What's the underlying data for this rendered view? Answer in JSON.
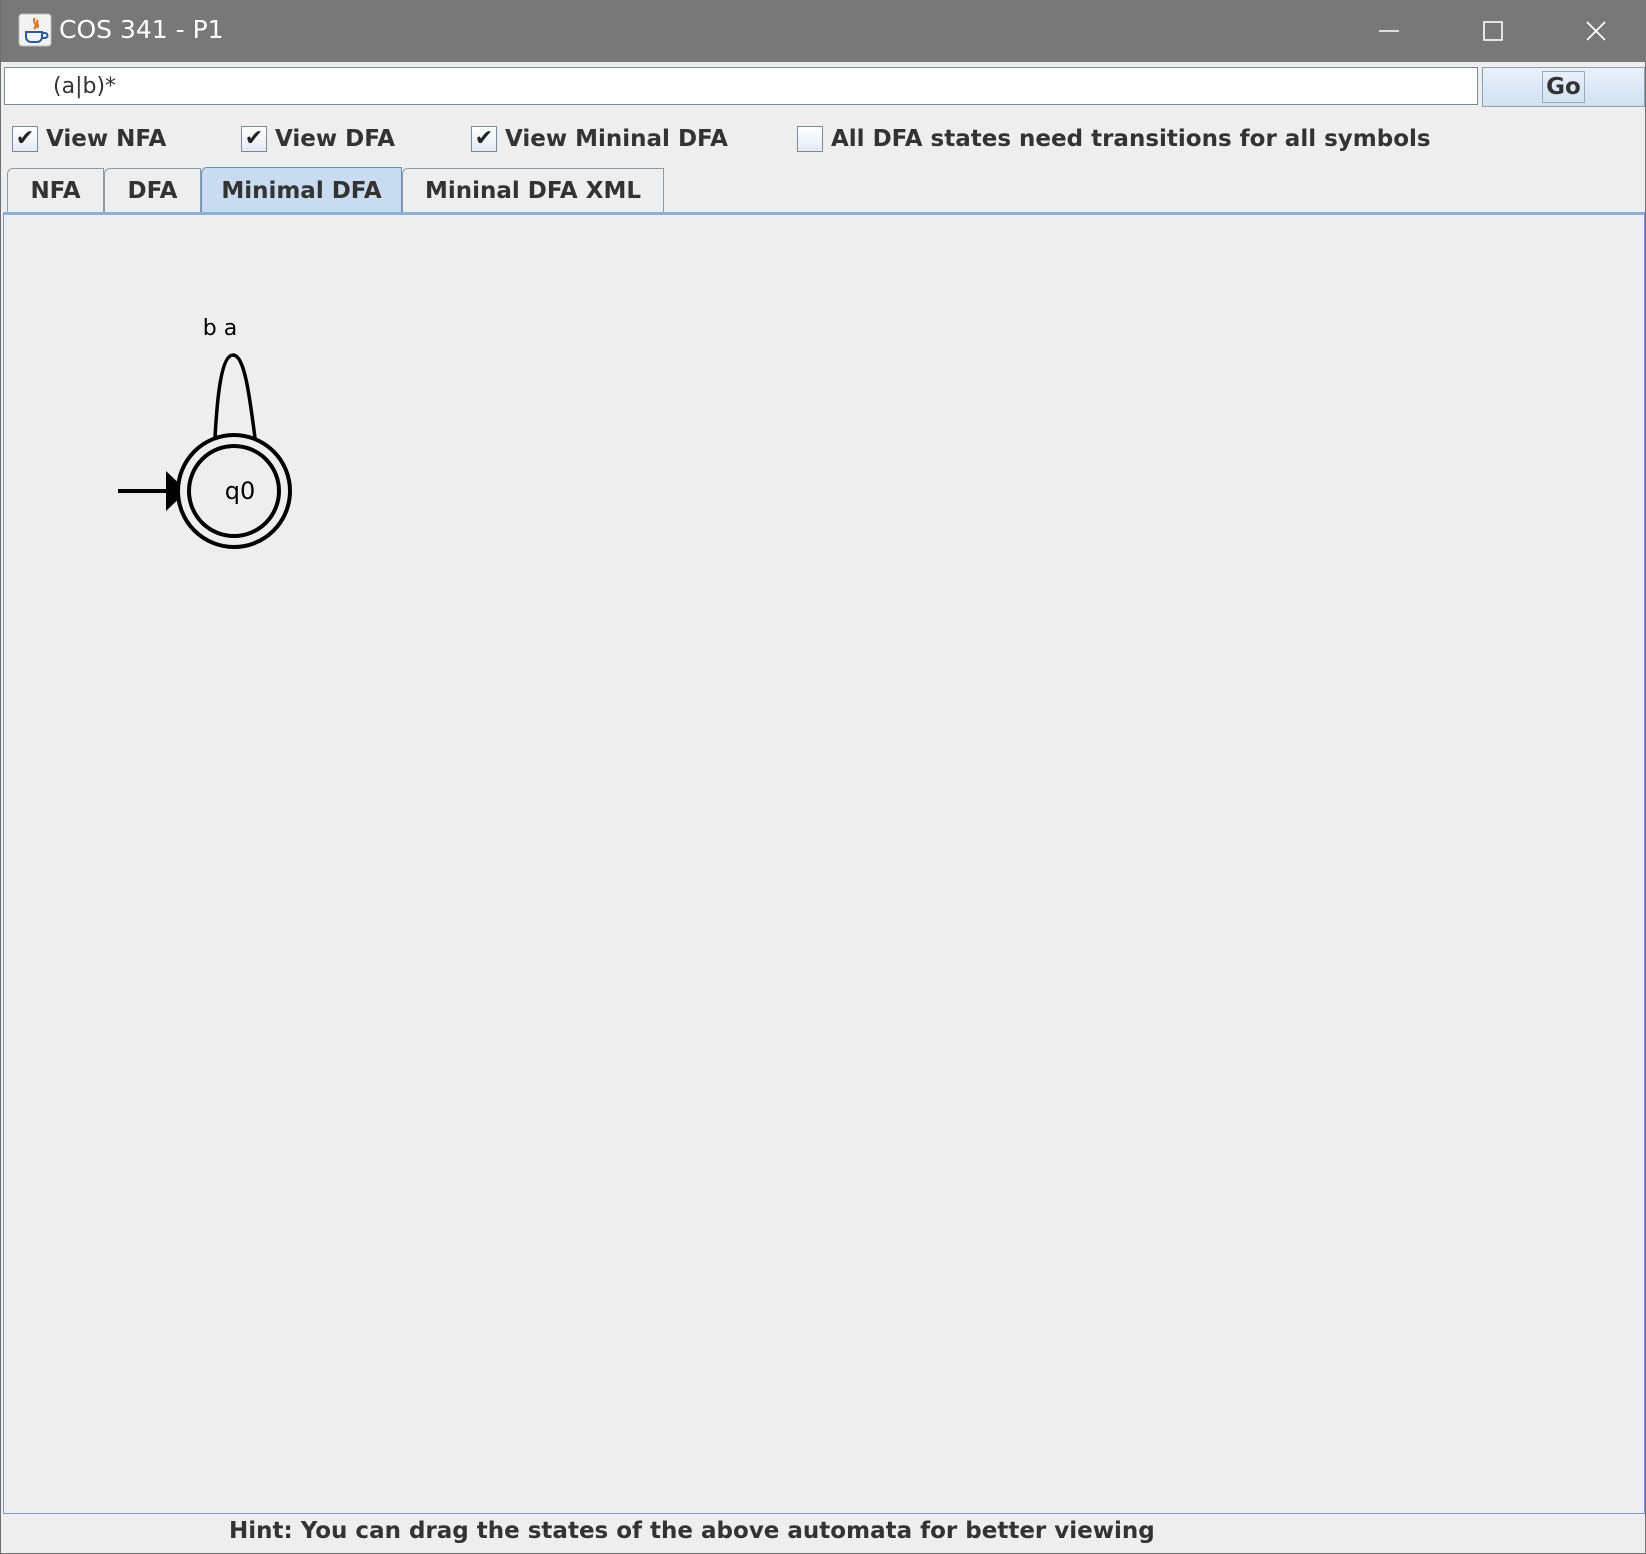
{
  "window": {
    "title": "COS 341 - P1",
    "app_icon": "java-icon",
    "controls": [
      "minimize-icon",
      "maximize-icon",
      "close-icon"
    ]
  },
  "regex": {
    "value": "(a|b)*",
    "go_label": "Go"
  },
  "options": [
    {
      "label": "View NFA",
      "checked": true
    },
    {
      "label": "View DFA",
      "checked": true
    },
    {
      "label": "View Mininal DFA",
      "checked": true
    },
    {
      "label": "All DFA states need transitions for all symbols",
      "checked": false
    }
  ],
  "tabs": [
    {
      "label": "NFA",
      "selected": false
    },
    {
      "label": "DFA",
      "selected": false
    },
    {
      "label": "Minimal DFA",
      "selected": true
    },
    {
      "label": "Mininal DFA XML",
      "selected": false
    }
  ],
  "automaton": {
    "states": [
      {
        "name": "q0",
        "start": true,
        "accepting": true
      }
    ],
    "transitions": [
      {
        "from": "q0",
        "to": "q0",
        "label": "b a"
      }
    ]
  },
  "hint": "Hint: You can drag the states of the above automata for better viewing"
}
